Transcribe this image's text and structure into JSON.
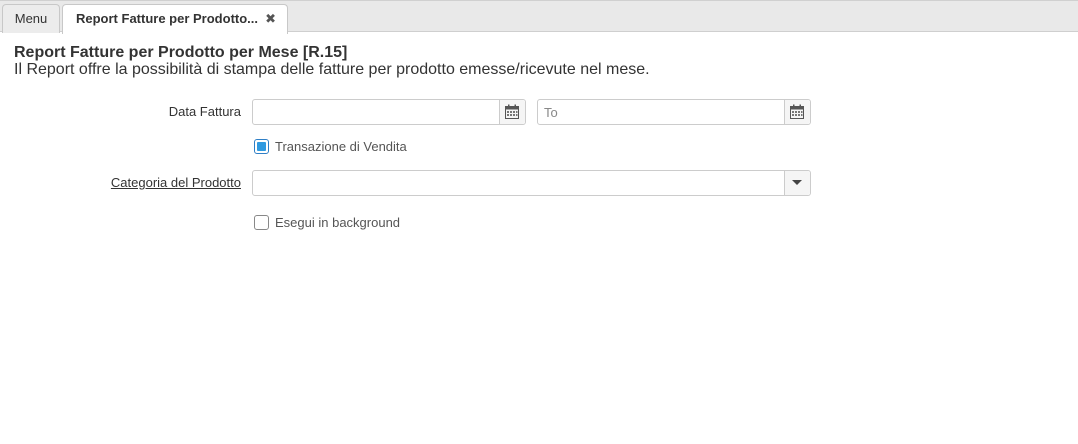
{
  "tabs": [
    {
      "label": "Menu"
    },
    {
      "label": "Report Fatture per Prodotto...",
      "close_icon": "×"
    }
  ],
  "header": {
    "title": "Report Fatture per Prodotto per Mese [R.15]",
    "description": "Il Report offre la possibilità di stampa delle fatture per prodotto emesse/ricevute nel mese."
  },
  "form": {
    "data_fattura": {
      "label": "Data Fattura",
      "from_value": "",
      "to_value": "",
      "to_placeholder": "To",
      "icon": "calendar-icon"
    },
    "transazione_vendita": {
      "label": "Transazione di Vendita",
      "checked": true
    },
    "categoria_prodotto": {
      "label": "Categoria del Prodotto",
      "value": "",
      "icon": "chevron-down-icon"
    },
    "esegui_background": {
      "label": "Esegui in background",
      "checked": false
    }
  },
  "colors": {
    "tabbar_bg": "#e9e9e9",
    "checkbox_accent": "#2f9ae0",
    "border": "#cccccc"
  }
}
